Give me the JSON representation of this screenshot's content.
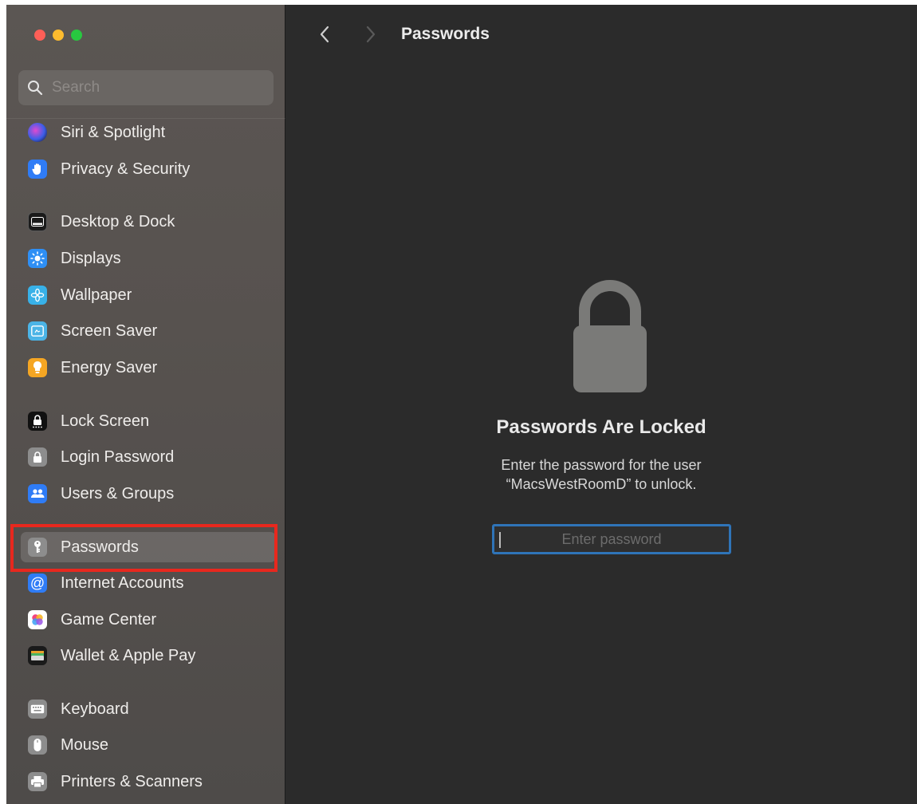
{
  "search": {
    "placeholder": "Search"
  },
  "sidebar": {
    "items": [
      {
        "label": "Siri & Spotlight",
        "icon": "siri-icon",
        "color": "#3a3a9c"
      },
      {
        "label": "Privacy & Security",
        "icon": "hand-icon",
        "color": "#2f7cf6"
      },
      {
        "label": "Desktop & Dock",
        "icon": "dock-icon",
        "color": "#1a1a1a"
      },
      {
        "label": "Displays",
        "icon": "sun-icon",
        "color": "#2e8ff5"
      },
      {
        "label": "Wallpaper",
        "icon": "flower-icon",
        "color": "#38b1e8"
      },
      {
        "label": "Screen Saver",
        "icon": "screensaver-icon",
        "color": "#4bb4e6"
      },
      {
        "label": "Energy Saver",
        "icon": "bulb-icon",
        "color": "#f5a623"
      },
      {
        "label": "Lock Screen",
        "icon": "lockscreen-icon",
        "color": "#111111"
      },
      {
        "label": "Login Password",
        "icon": "lock-icon",
        "color": "#8d8d8d"
      },
      {
        "label": "Users & Groups",
        "icon": "users-icon",
        "color": "#2f7cf6"
      },
      {
        "label": "Passwords",
        "icon": "key-icon",
        "color": "#8d8d8d"
      },
      {
        "label": "Internet Accounts",
        "icon": "at-icon",
        "color": "#2f7cf6"
      },
      {
        "label": "Game Center",
        "icon": "gamecenter-icon",
        "color": "#ffffff"
      },
      {
        "label": "Wallet & Apple Pay",
        "icon": "wallet-icon",
        "color": "#1a1a1a"
      },
      {
        "label": "Keyboard",
        "icon": "keyboard-icon",
        "color": "#8d8d8d"
      },
      {
        "label": "Mouse",
        "icon": "mouse-icon",
        "color": "#8d8d8d"
      },
      {
        "label": "Printers & Scanners",
        "icon": "printer-icon",
        "color": "#8d8d8d"
      }
    ],
    "selected": "Passwords"
  },
  "header": {
    "title": "Passwords"
  },
  "main": {
    "locked_title": "Passwords Are Locked",
    "desc_line1": "Enter the password for the user",
    "desc_line2": "“MacsWestRoomD” to unlock.",
    "password_placeholder": "Enter password",
    "password_value": ""
  },
  "colors": {
    "accent": "#2f74b8",
    "highlight": "#e8281e"
  }
}
